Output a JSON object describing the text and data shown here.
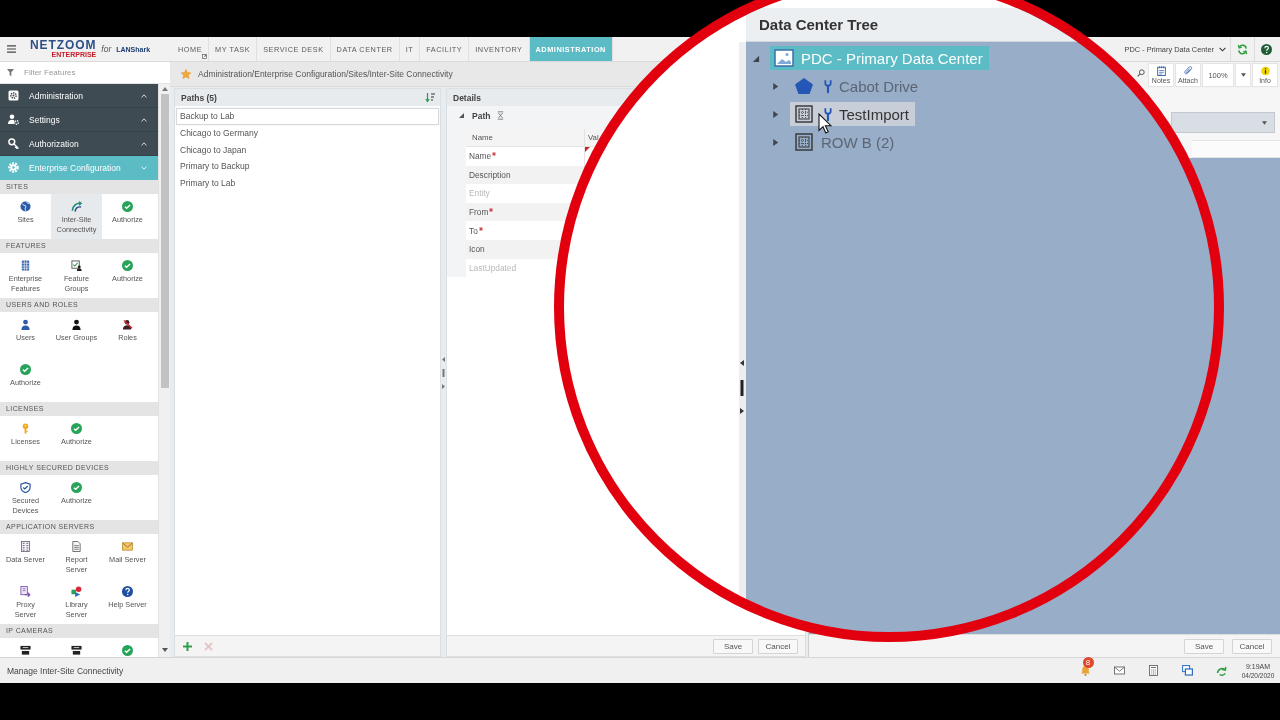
{
  "header": {
    "logo": {
      "name": "NETZOOM",
      "edition": "ENTERPRISE",
      "connector": "for",
      "partner": "LANShark"
    },
    "nav_tabs": [
      {
        "label": "HOME",
        "selected": false,
        "popout": true
      },
      {
        "label": "MY TASK",
        "selected": false,
        "popout": false
      },
      {
        "label": "SERVICE DESK",
        "selected": false,
        "popout": false
      },
      {
        "label": "DATA CENTER",
        "selected": false,
        "popout": false
      },
      {
        "label": "IT",
        "selected": false,
        "popout": false
      },
      {
        "label": "FACILITY",
        "selected": false,
        "popout": false
      },
      {
        "label": "INVENTORY",
        "selected": false,
        "popout": false
      },
      {
        "label": "ADMINISTRATION",
        "selected": true,
        "popout": false
      }
    ],
    "site_selector": {
      "value": "PDC - Primary Data Center"
    }
  },
  "sidebar": {
    "filter": {
      "placeholder": "Filter Features"
    },
    "menu": [
      {
        "label": "Administration",
        "expanded": false
      },
      {
        "label": "Settings",
        "expanded": false
      },
      {
        "label": "Authorization",
        "expanded": false
      },
      {
        "label": "Enterprise Configuration",
        "expanded": true
      }
    ],
    "sections": [
      {
        "title": "SITES",
        "items": [
          {
            "kind": "sites",
            "label": "Sites",
            "selected": false
          },
          {
            "kind": "connectivity",
            "label": "Inter-Site Connectivity",
            "selected": true
          },
          {
            "kind": "authorize",
            "label": "Authorize",
            "selected": false
          }
        ]
      },
      {
        "title": "FEATURES",
        "items": [
          {
            "kind": "features",
            "label": "Enterprise Features",
            "selected": false
          },
          {
            "kind": "groups",
            "label": "Feature Groups",
            "selected": false
          },
          {
            "kind": "authorize",
            "label": "Authorize",
            "selected": false
          }
        ]
      },
      {
        "title": "USERS AND ROLES",
        "items": [
          {
            "kind": "user",
            "label": "Users",
            "selected": false
          },
          {
            "kind": "usergroups",
            "label": "User Groups",
            "selected": false
          },
          {
            "kind": "roles",
            "label": "Roles",
            "selected": false
          },
          {
            "kind": "authorize",
            "label": "Authorize",
            "selected": false
          }
        ]
      },
      {
        "title": "LICENSES",
        "items": [
          {
            "kind": "license",
            "label": "Licenses",
            "selected": false
          },
          {
            "kind": "authorize",
            "label": "Authorize",
            "selected": false
          }
        ]
      },
      {
        "title": "HIGHLY SECURED DEVICES",
        "items": [
          {
            "kind": "secured",
            "label": "Secured Devices",
            "selected": false
          },
          {
            "kind": "authorize",
            "label": "Authorize",
            "selected": false
          }
        ]
      },
      {
        "title": "APPLICATION SERVERS",
        "items": [
          {
            "kind": "dataserver",
            "label": "Data Server",
            "selected": false
          },
          {
            "kind": "report",
            "label": "Report Server",
            "selected": false
          },
          {
            "kind": "mail",
            "label": "Mail Server",
            "selected": false
          },
          {
            "kind": "proxy",
            "label": "Proxy Server",
            "selected": false
          },
          {
            "kind": "library",
            "label": "Library Server",
            "selected": false
          },
          {
            "kind": "help",
            "label": "Help Server",
            "selected": false
          }
        ]
      },
      {
        "title": "IP CAMERAS",
        "items": [
          {
            "kind": "camera",
            "selected": false
          },
          {
            "kind": "camera",
            "selected": false
          },
          {
            "kind": "authorize",
            "selected": false
          }
        ]
      }
    ]
  },
  "breadcrumb": {
    "favorite": true,
    "path": "Administration/Enterprise Configuration/Sites/Inter-Site Connectivity"
  },
  "paths_panel": {
    "title": "Paths (5)",
    "items": [
      {
        "label": "Backup to Lab",
        "selected": true
      },
      {
        "label": "Chicago to Germany",
        "selected": false
      },
      {
        "label": "Chicago to Japan",
        "selected": false
      },
      {
        "label": "Primary to Backup",
        "selected": false
      },
      {
        "label": "Primary to Lab",
        "selected": false
      }
    ],
    "actions": [
      {
        "kind": "add",
        "disabled": false
      },
      {
        "kind": "delete",
        "disabled": true
      }
    ]
  },
  "details_panel": {
    "title": "Details",
    "group": {
      "title": "Path",
      "expanded": true
    },
    "columns": [
      "Name",
      "Val"
    ],
    "rows": [
      {
        "label": "Name",
        "required": true,
        "disabled": false,
        "invalid": true
      },
      {
        "label": "Description",
        "required": false,
        "disabled": false
      },
      {
        "label": "Entity",
        "required": false,
        "disabled": true
      },
      {
        "label": "From",
        "required": true,
        "disabled": false
      },
      {
        "label": "To",
        "required": true,
        "disabled": false
      },
      {
        "label": "Icon",
        "required": false,
        "disabled": false
      },
      {
        "label": "LastUpdated",
        "required": false,
        "disabled": true
      }
    ],
    "buttons": [
      "Save",
      "Cancel"
    ]
  },
  "view_toolbar": {
    "items": [
      {
        "kind": "search"
      },
      {
        "kind": "notes",
        "label": "Notes"
      },
      {
        "kind": "attach",
        "label": "Attach"
      },
      {
        "kind": "zoom",
        "value": "100%"
      },
      {
        "kind": "dropdown"
      },
      {
        "kind": "info",
        "label": "Info"
      }
    ]
  },
  "right_panel": {
    "buttons": [
      "Save",
      "Cancel"
    ]
  },
  "zoom_callout": {
    "title": "Data Center Tree",
    "tree": [
      {
        "label": "PDC - Primary Data Center",
        "kind": "datacenter",
        "expanded": true,
        "selected": true,
        "hovered": false,
        "tool_icon": false,
        "children": [
          {
            "label": "Cabot Drive",
            "kind": "site",
            "expanded": false,
            "selected": false,
            "hovered": false,
            "tool_icon": true
          },
          {
            "label": "TestImport",
            "kind": "row",
            "expanded": false,
            "selected": false,
            "hovered": true,
            "tool_icon": true
          },
          {
            "label": "ROW B (2)",
            "kind": "row",
            "expanded": false,
            "selected": false,
            "hovered": false,
            "tool_icon": false
          }
        ]
      }
    ]
  },
  "status_bar": {
    "message": "Manage Inter-Site Connectivity",
    "notification_count": "8",
    "time": "9:19AM",
    "date": "04/20/2020"
  }
}
